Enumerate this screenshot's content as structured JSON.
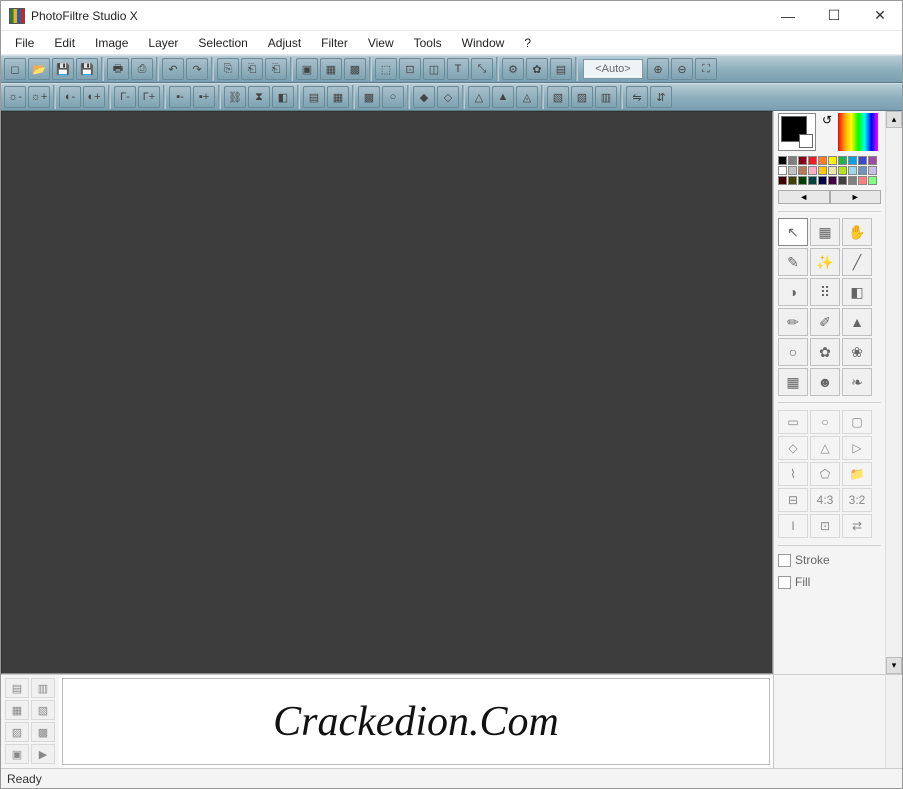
{
  "window": {
    "title": "PhotoFiltre Studio X",
    "min": "—",
    "max": "☐",
    "close": "✕"
  },
  "menu": [
    "File",
    "Edit",
    "Image",
    "Layer",
    "Selection",
    "Adjust",
    "Filter",
    "View",
    "Tools",
    "Window",
    "?"
  ],
  "toolbar1": {
    "zoom_value": "<Auto>",
    "icons": [
      "new",
      "open",
      "save",
      "saveas",
      "print",
      "scan",
      "undo",
      "redo",
      "copy",
      "paste",
      "paste-special",
      "layer1",
      "layer2",
      "layer3",
      "image-size",
      "canvas-size",
      "selection",
      "text",
      "transform",
      "plugin1",
      "plugin2",
      "explorer"
    ]
  },
  "toolbar2": {
    "icons": [
      "bright-",
      "bright+",
      "contrast-",
      "contrast+",
      "gamma-",
      "gamma+",
      "sat-",
      "sat+",
      "histogram",
      "auto-levels",
      "gray",
      "sepia",
      "dither1",
      "dither2",
      "blur",
      "sharpen",
      "soften",
      "relief",
      "emboss",
      "edge",
      "mirror-h",
      "mirror-v"
    ]
  },
  "palette_colors": [
    "#000000",
    "#7f7f7f",
    "#880015",
    "#ed1c24",
    "#ff7f27",
    "#fff200",
    "#22b14c",
    "#00a2e8",
    "#3f48cc",
    "#a349a4",
    "#ffffff",
    "#c3c3c3",
    "#b97a57",
    "#ffaec9",
    "#ffc90e",
    "#efe4b0",
    "#b5e61d",
    "#99d9ea",
    "#7092be",
    "#c8bfe7",
    "#400000",
    "#404000",
    "#004000",
    "#004040",
    "#000040",
    "#400040",
    "#404040",
    "#808080",
    "#ff8080",
    "#80ff80"
  ],
  "tools": [
    {
      "n": "pointer",
      "g": "↖",
      "active": true
    },
    {
      "n": "selection-tool",
      "g": "▦"
    },
    {
      "n": "hand",
      "g": "✋"
    },
    {
      "n": "eyedropper",
      "g": "✎"
    },
    {
      "n": "wand",
      "g": "✨"
    },
    {
      "n": "line",
      "g": "╱"
    },
    {
      "n": "fill",
      "g": "◑"
    },
    {
      "n": "spray",
      "g": "⠿"
    },
    {
      "n": "eraser",
      "g": "◧"
    },
    {
      "n": "brush",
      "g": "✏"
    },
    {
      "n": "adv-brush",
      "g": "✐"
    },
    {
      "n": "stamp",
      "g": "▲"
    },
    {
      "n": "blur",
      "g": "○"
    },
    {
      "n": "smudge",
      "g": "✿"
    },
    {
      "n": "clone",
      "g": "❀"
    },
    {
      "n": "pattern",
      "g": "▦"
    },
    {
      "n": "portrait",
      "g": "☻"
    },
    {
      "n": "art",
      "g": "❧"
    }
  ],
  "shapes": [
    {
      "n": "rect",
      "g": "▭"
    },
    {
      "n": "circle",
      "g": "○"
    },
    {
      "n": "round-rect",
      "g": "▢"
    },
    {
      "n": "diamond",
      "g": "◇"
    },
    {
      "n": "triangle",
      "g": "△"
    },
    {
      "n": "triangle-r",
      "g": "▷"
    },
    {
      "n": "lasso",
      "g": "⌇"
    },
    {
      "n": "poly",
      "g": "⬠"
    },
    {
      "n": "folder",
      "g": "📁"
    },
    {
      "n": "ratio-free",
      "g": "⊟"
    },
    {
      "n": "ratio-43",
      "g": "4:3"
    },
    {
      "n": "ratio-32",
      "g": "3:2"
    },
    {
      "n": "invert",
      "g": "I"
    },
    {
      "n": "bounds",
      "g": "⊡"
    },
    {
      "n": "swap",
      "g": "⇄"
    }
  ],
  "options": {
    "stroke": "Stroke",
    "fill": "Fill"
  },
  "layer_icons": [
    "l1",
    "l2",
    "l3",
    "l4",
    "l5",
    "l6",
    "l7",
    "play"
  ],
  "watermark": "Crackedion.Com",
  "status": "Ready",
  "scroll": {
    "left": "◄",
    "right": "►",
    "up": "▴",
    "down": "▾"
  }
}
